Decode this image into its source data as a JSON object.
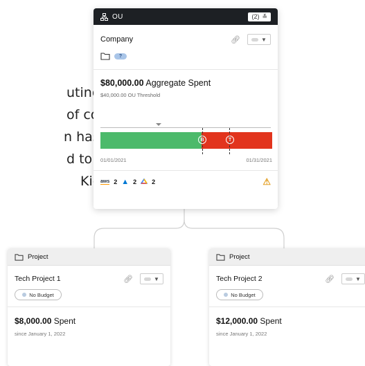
{
  "background_text": {
    "lines": [
      "uting",
      "of costs.",
      "n has",
      "d to cost",
      "Kion"
    ]
  },
  "ou_card": {
    "header_label": "OU",
    "count_label": "(2)",
    "name": "Company",
    "child_badge": "?",
    "amount": "$80,000.00",
    "amount_suffix": "Aggregate Spent",
    "threshold": "$40,000.00 OU Threshold",
    "marker_budget": "B",
    "marker_threshold": "T",
    "start_date": "01/01/2021",
    "end_date": "01/31/2021",
    "clouds": [
      {
        "name": "aws",
        "label": "aws",
        "count": "2"
      },
      {
        "name": "azure",
        "count": "2"
      },
      {
        "name": "gcp",
        "count": "2"
      }
    ],
    "colors": {
      "header_bg": "#1d2024",
      "bar_green": "#4cba6b",
      "bar_red": "#e2341d",
      "warning": "#e4a22a"
    },
    "progress_fraction": 0.59
  },
  "projects": [
    {
      "header_label": "Project",
      "name": "Tech Project 1",
      "budget_badge": "No Budget",
      "amount": "$8,000.00",
      "amount_suffix": "Spent",
      "since": "since January 1, 2022"
    },
    {
      "header_label": "Project",
      "name": "Tech Project 2",
      "budget_badge": "No Budget",
      "amount": "$12,000.00",
      "amount_suffix": "Spent",
      "since": "since January 1, 2022"
    }
  ]
}
